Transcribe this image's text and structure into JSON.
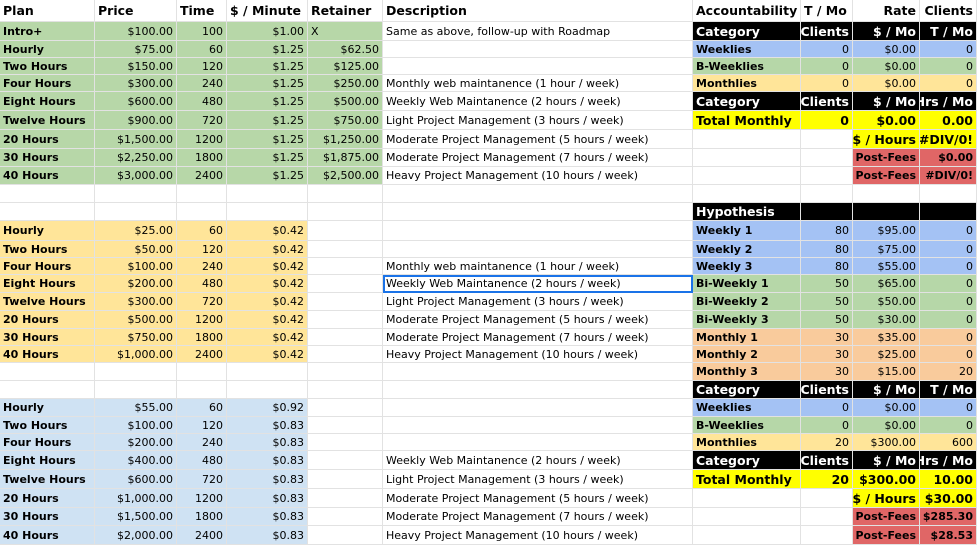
{
  "headers": {
    "plan": "Plan",
    "price": "Price",
    "time": "Time",
    "per_minute": "$ / Minute",
    "retainer": "Retainer",
    "description": "Description",
    "accountability": "Accountability",
    "t_mo": "T / Mo",
    "rate": "Rate",
    "clients": "Clients"
  },
  "tier1": [
    {
      "plan": "Intro+",
      "price": "$100.00",
      "time": "100",
      "per_minute": "$1.00",
      "retainer": "X",
      "description": "Same as above, follow-up with Roadmap"
    },
    {
      "plan": "Hourly",
      "price": "$75.00",
      "time": "60",
      "per_minute": "$1.25",
      "retainer": "$62.50",
      "description": ""
    },
    {
      "plan": "Two Hours",
      "price": "$150.00",
      "time": "120",
      "per_minute": "$1.25",
      "retainer": "$125.00",
      "description": ""
    },
    {
      "plan": "Four Hours",
      "price": "$300.00",
      "time": "240",
      "per_minute": "$1.25",
      "retainer": "$250.00",
      "description": "Monthly web maintanence (1 hour / week)"
    },
    {
      "plan": "Eight Hours",
      "price": "$600.00",
      "time": "480",
      "per_minute": "$1.25",
      "retainer": "$500.00",
      "description": "Weekly Web Maintanence (2 hours / week)"
    },
    {
      "plan": "Twelve Hours",
      "price": "$900.00",
      "time": "720",
      "per_minute": "$1.25",
      "retainer": "$750.00",
      "description": "Light Project Management (3 hours / week)"
    },
    {
      "plan": "20 Hours",
      "price": "$1,500.00",
      "time": "1200",
      "per_minute": "$1.25",
      "retainer": "$1,250.00",
      "description": "Moderate Project Management (5 hours / week)"
    },
    {
      "plan": "30 Hours",
      "price": "$2,250.00",
      "time": "1800",
      "per_minute": "$1.25",
      "retainer": "$1,875.00",
      "description": "Moderate Project Management (7 hours / week)"
    },
    {
      "plan": "40 Hours",
      "price": "$3,000.00",
      "time": "2400",
      "per_minute": "$1.25",
      "retainer": "$2,500.00",
      "description": "Heavy Project Management (10 hours / week)"
    }
  ],
  "tier2": [
    {
      "plan": "Hourly",
      "price": "$25.00",
      "time": "60",
      "per_minute": "$0.42",
      "description": ""
    },
    {
      "plan": "Two Hours",
      "price": "$50.00",
      "time": "120",
      "per_minute": "$0.42",
      "description": ""
    },
    {
      "plan": "Four Hours",
      "price": "$100.00",
      "time": "240",
      "per_minute": "$0.42",
      "description": "Monthly web maintanence (1 hour / week)"
    },
    {
      "plan": "Eight Hours",
      "price": "$200.00",
      "time": "480",
      "per_minute": "$0.42",
      "description": "Weekly Web Maintanence (2 hours / week)"
    },
    {
      "plan": "Twelve Hours",
      "price": "$300.00",
      "time": "720",
      "per_minute": "$0.42",
      "description": "Light Project Management (3 hours / week)"
    },
    {
      "plan": "20 Hours",
      "price": "$500.00",
      "time": "1200",
      "per_minute": "$0.42",
      "description": "Moderate Project Management (5 hours / week)"
    },
    {
      "plan": "30 Hours",
      "price": "$750.00",
      "time": "1800",
      "per_minute": "$0.42",
      "description": "Moderate Project Management (7 hours / week)"
    },
    {
      "plan": "40 Hours",
      "price": "$1,000.00",
      "time": "2400",
      "per_minute": "$0.42",
      "description": "Heavy Project Management (10 hours / week)"
    }
  ],
  "tier3": [
    {
      "plan": "Hourly",
      "price": "$55.00",
      "time": "60",
      "per_minute": "$0.92",
      "description": ""
    },
    {
      "plan": "Two Hours",
      "price": "$100.00",
      "time": "120",
      "per_minute": "$0.83",
      "description": ""
    },
    {
      "plan": "Four Hours",
      "price": "$200.00",
      "time": "240",
      "per_minute": "$0.83",
      "description": ""
    },
    {
      "plan": "Eight Hours",
      "price": "$400.00",
      "time": "480",
      "per_minute": "$0.83",
      "description": "Weekly Web Maintanence (2 hours / week)"
    },
    {
      "plan": "Twelve Hours",
      "price": "$600.00",
      "time": "720",
      "per_minute": "$0.83",
      "description": "Light Project Management (3 hours / week)"
    },
    {
      "plan": "20 Hours",
      "price": "$1,000.00",
      "time": "1200",
      "per_minute": "$0.83",
      "description": "Moderate Project Management (5 hours / week)"
    },
    {
      "plan": "30 Hours",
      "price": "$1,500.00",
      "time": "1800",
      "per_minute": "$0.83",
      "description": "Moderate Project Management (7 hours / week)"
    },
    {
      "plan": "40 Hours",
      "price": "$2,000.00",
      "time": "2400",
      "per_minute": "$0.83",
      "description": "Heavy Project Management (10 hours / week)"
    }
  ],
  "acc1": {
    "header": {
      "a": "Category",
      "b": "Clients",
      "c": "$ / Mo",
      "d": "T / Mo"
    },
    "rows": [
      {
        "a": "Weeklies",
        "b": "0",
        "c": "$0.00",
        "d": "0"
      },
      {
        "a": "B-Weeklies",
        "b": "0",
        "c": "$0.00",
        "d": "0"
      },
      {
        "a": "Monthlies",
        "b": "0",
        "c": "$0.00",
        "d": "0"
      }
    ],
    "header2": {
      "a": "Category",
      "b": "Clients",
      "c": "$ / Mo",
      "d": "Hrs / Mo"
    },
    "total": {
      "a": "Total Monthly",
      "b": "0",
      "c": "$0.00",
      "d": "0.00"
    },
    "per_hours": {
      "label": "$ / Hours",
      "value": "#DIV/0!"
    },
    "post_fees1": {
      "label": "Post-Fees",
      "value": "$0.00"
    },
    "post_fees2": {
      "label": "Post-Fees",
      "value": "#DIV/0!"
    }
  },
  "hypothesis": {
    "title": "Hypothesis",
    "rows": [
      {
        "a": "Weekly 1",
        "b": "80",
        "c": "$95.00",
        "d": "0"
      },
      {
        "a": "Weekly 2",
        "b": "80",
        "c": "$75.00",
        "d": "0"
      },
      {
        "a": "Weekly 3",
        "b": "80",
        "c": "$55.00",
        "d": "0"
      },
      {
        "a": "Bi-Weekly 1",
        "b": "50",
        "c": "$65.00",
        "d": "0"
      },
      {
        "a": "Bi-Weekly 2",
        "b": "50",
        "c": "$50.00",
        "d": "0"
      },
      {
        "a": "Bi-Weekly 3",
        "b": "50",
        "c": "$30.00",
        "d": "0"
      },
      {
        "a": "Monthly 1",
        "b": "30",
        "c": "$35.00",
        "d": "0"
      },
      {
        "a": "Monthly 2",
        "b": "30",
        "c": "$25.00",
        "d": "0"
      },
      {
        "a": "Monthly 3",
        "b": "30",
        "c": "$15.00",
        "d": "20"
      }
    ]
  },
  "acc2": {
    "header": {
      "a": "Category",
      "b": "Clients",
      "c": "$ / Mo",
      "d": "T / Mo"
    },
    "rows": [
      {
        "a": "Weeklies",
        "b": "0",
        "c": "$0.00",
        "d": "0"
      },
      {
        "a": "B-Weeklies",
        "b": "0",
        "c": "$0.00",
        "d": "0"
      },
      {
        "a": "Monthlies",
        "b": "20",
        "c": "$300.00",
        "d": "600"
      }
    ],
    "header2": {
      "a": "Category",
      "b": "Clients",
      "c": "$ / Mo",
      "d": "Hrs / Mo"
    },
    "total": {
      "a": "Total Monthly",
      "b": "20",
      "c": "$300.00",
      "d": "10.00"
    },
    "per_hours": {
      "label": "$ / Hours",
      "value": "$30.00"
    },
    "post_fees1": {
      "label": "Post-Fees",
      "value": "$285.30"
    },
    "post_fees2": {
      "label": "Post-Fees",
      "value": "$28.53"
    }
  }
}
